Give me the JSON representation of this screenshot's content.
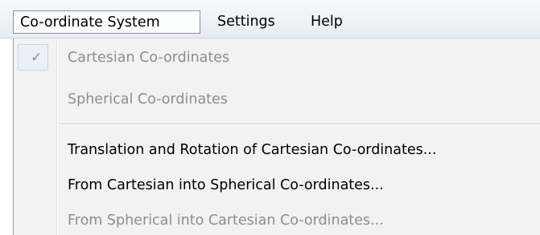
{
  "menubar": {
    "items": [
      {
        "label": "Co-ordinate System"
      },
      {
        "label": "Settings"
      },
      {
        "label": "Help"
      }
    ]
  },
  "dropdown": {
    "check_glyph": "✓",
    "items": [
      {
        "label": "Cartesian Co-ordinates",
        "checked": true,
        "enabled": false
      },
      {
        "label": "Spherical Co-ordinates",
        "checked": false,
        "enabled": false
      },
      {
        "label": "Translation and Rotation of Cartesian Co-ordinates...",
        "checked": false,
        "enabled": true
      },
      {
        "label": "From Cartesian into Spherical Co-ordinates...",
        "checked": false,
        "enabled": true
      },
      {
        "label": "From Spherical into Cartesian Co-ordinates...",
        "checked": false,
        "enabled": false
      }
    ]
  }
}
